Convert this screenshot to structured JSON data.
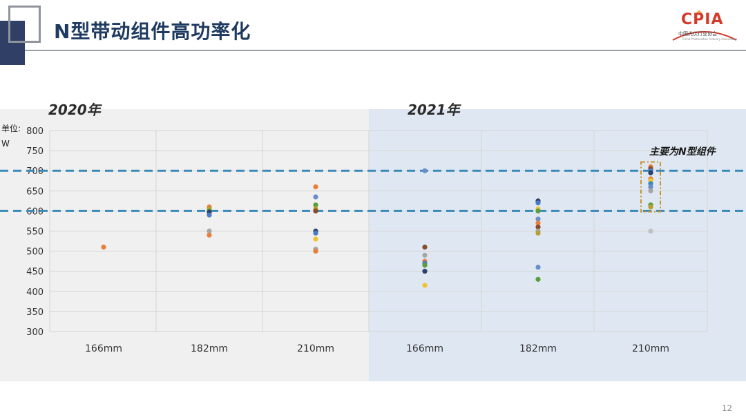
{
  "slide": {
    "title": "N型带动组件高功率化",
    "page_number": "12",
    "logo": {
      "text": "CPIA",
      "subtitle": "中国光伏行业协会",
      "subtitle_en": "China Photovoltaic Industry Association"
    }
  },
  "chart_data": {
    "type": "scatter",
    "unit_label_line1": "单位:",
    "unit_label_line2": "W",
    "ylim": [
      300,
      800
    ],
    "y_ticks": [
      300,
      350,
      400,
      450,
      500,
      550,
      600,
      650,
      700,
      750,
      800
    ],
    "grid": true,
    "periods": [
      {
        "label": "2020年",
        "background": "#f0f0f0"
      },
      {
        "label": "2021年",
        "background": "#dfe8f2"
      }
    ],
    "categories": [
      {
        "label": "166mm",
        "period": 0
      },
      {
        "label": "182mm",
        "period": 0
      },
      {
        "label": "210mm",
        "period": 0
      },
      {
        "label": "166mm",
        "period": 1
      },
      {
        "label": "182mm",
        "period": 1
      },
      {
        "label": "210mm",
        "period": 1
      }
    ],
    "reference_lines": [
      {
        "value": 700,
        "style": "dashed",
        "color": "#3a8ab8"
      },
      {
        "value": 600,
        "style": "dashed",
        "color": "#3a8ab8"
      }
    ],
    "annotation": {
      "text": "主要为N型组件",
      "category_index": 5,
      "range": [
        605,
        715
      ],
      "color": "#c8952c"
    },
    "points": [
      {
        "c": 0,
        "y": 510,
        "color": "#e8803a"
      },
      {
        "c": 1,
        "y": 610,
        "color": "#e8803a"
      },
      {
        "c": 1,
        "y": 605,
        "color": "#b8a030"
      },
      {
        "c": 1,
        "y": 600,
        "color": "#5a9e3c"
      },
      {
        "c": 1,
        "y": 597,
        "color": "#2d3f6b"
      },
      {
        "c": 1,
        "y": 590,
        "color": "#4a7cc4"
      },
      {
        "c": 1,
        "y": 550,
        "color": "#a6a6a6"
      },
      {
        "c": 1,
        "y": 540,
        "color": "#e8803a"
      },
      {
        "c": 2,
        "y": 660,
        "color": "#e8803a"
      },
      {
        "c": 2,
        "y": 635,
        "color": "#6a8cc8"
      },
      {
        "c": 2,
        "y": 615,
        "color": "#5a9e3c"
      },
      {
        "c": 2,
        "y": 605,
        "color": "#b8a030"
      },
      {
        "c": 2,
        "y": 600,
        "color": "#8b4a2c"
      },
      {
        "c": 2,
        "y": 550,
        "color": "#2d3f6b"
      },
      {
        "c": 2,
        "y": 545,
        "color": "#4a7cc4"
      },
      {
        "c": 2,
        "y": 530,
        "color": "#f2c230"
      },
      {
        "c": 2,
        "y": 505,
        "color": "#a6a6a6"
      },
      {
        "c": 2,
        "y": 500,
        "color": "#e8803a"
      },
      {
        "c": 3,
        "y": 700,
        "color": "#6a8cc8"
      },
      {
        "c": 3,
        "y": 510,
        "color": "#8b4a2c"
      },
      {
        "c": 3,
        "y": 490,
        "color": "#a6a6a6"
      },
      {
        "c": 3,
        "y": 475,
        "color": "#e8803a"
      },
      {
        "c": 3,
        "y": 470,
        "color": "#4a7cc4"
      },
      {
        "c": 3,
        "y": 465,
        "color": "#5a9e3c"
      },
      {
        "c": 3,
        "y": 450,
        "color": "#2d3f6b"
      },
      {
        "c": 3,
        "y": 415,
        "color": "#f2c230"
      },
      {
        "c": 4,
        "y": 625,
        "color": "#2d3f6b"
      },
      {
        "c": 4,
        "y": 620,
        "color": "#4a7cc4"
      },
      {
        "c": 4,
        "y": 605,
        "color": "#f2c230"
      },
      {
        "c": 4,
        "y": 600,
        "color": "#5a9e3c"
      },
      {
        "c": 4,
        "y": 580,
        "color": "#6a8cc8"
      },
      {
        "c": 4,
        "y": 570,
        "color": "#e8803a"
      },
      {
        "c": 4,
        "y": 560,
        "color": "#8b4a2c"
      },
      {
        "c": 4,
        "y": 550,
        "color": "#a6a6a6"
      },
      {
        "c": 4,
        "y": 545,
        "color": "#b8a030"
      },
      {
        "c": 4,
        "y": 460,
        "color": "#6a8cc8"
      },
      {
        "c": 4,
        "y": 430,
        "color": "#5a9e3c"
      },
      {
        "c": 5,
        "y": 710,
        "color": "#e8803a"
      },
      {
        "c": 5,
        "y": 705,
        "color": "#8b4a2c"
      },
      {
        "c": 5,
        "y": 700,
        "color": "#4a7cc4"
      },
      {
        "c": 5,
        "y": 695,
        "color": "#2d3f6b"
      },
      {
        "c": 5,
        "y": 680,
        "color": "#e8803a"
      },
      {
        "c": 5,
        "y": 675,
        "color": "#f2c230"
      },
      {
        "c": 5,
        "y": 668,
        "color": "#3a8ab8"
      },
      {
        "c": 5,
        "y": 660,
        "color": "#6a8cc8"
      },
      {
        "c": 5,
        "y": 650,
        "color": "#a6a6a6"
      },
      {
        "c": 5,
        "y": 615,
        "color": "#5a9e3c"
      },
      {
        "c": 5,
        "y": 610,
        "color": "#b8a030"
      },
      {
        "c": 5,
        "y": 550,
        "color": "#c0c0c0"
      }
    ]
  }
}
